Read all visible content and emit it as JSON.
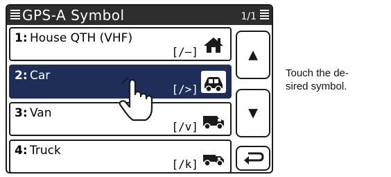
{
  "screen": {
    "title": "GPS-A Symbol",
    "page_indicator": "1/1",
    "items": [
      {
        "number": "1:",
        "name": "House QTH (VHF)",
        "code": "[/–]",
        "icon": "house-icon",
        "selected": false
      },
      {
        "number": "2:",
        "name": "Car",
        "code": "[/>]",
        "icon": "car-icon",
        "selected": true
      },
      {
        "number": "3:",
        "name": "Van",
        "code": "[/v]",
        "icon": "van-icon",
        "selected": false
      },
      {
        "number": "4:",
        "name": "Truck",
        "code": "[/k]",
        "icon": "truck-icon",
        "selected": false
      }
    ],
    "buttons": {
      "up": "▲",
      "down": "▼",
      "back_icon": "return-icon"
    }
  },
  "caption": {
    "line1": "Touch the de-",
    "line2": "sired symbol."
  },
  "colors": {
    "titlebar": "#2d2d2d",
    "selected_row": "#1f2e58"
  }
}
